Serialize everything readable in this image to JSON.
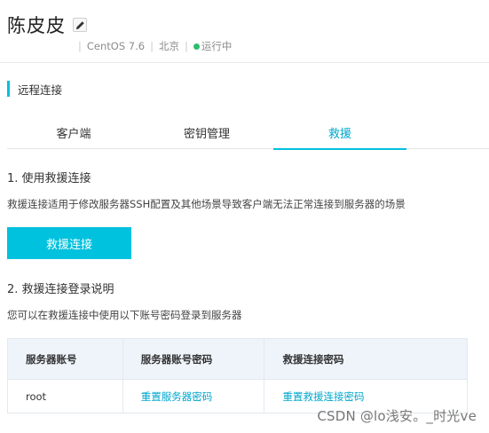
{
  "header": {
    "title": "陈皮皮",
    "os": "CentOS 7.6",
    "region": "北京",
    "status": "运行中",
    "status_color": "#2dbd6e"
  },
  "section": {
    "title": "远程连接"
  },
  "tabs": [
    {
      "label": "客户端",
      "active": false
    },
    {
      "label": "密钥管理",
      "active": false
    },
    {
      "label": "救援",
      "active": true
    }
  ],
  "step1": {
    "heading": "1. 使用救援连接",
    "description": "救援连接适用于修改服务器SSH配置及其他场景导致客户端无法正常连接到服务器的场景",
    "button_label": "救援连接"
  },
  "step2": {
    "heading": "2. 救援连接登录说明",
    "description": "您可以在救援连接中使用以下账号密码登录到服务器"
  },
  "table": {
    "headers": [
      "服务器账号",
      "服务器账号密码",
      "救援连接密码"
    ],
    "rows": [
      [
        "root",
        "重置服务器密码",
        "重置救援连接密码"
      ]
    ]
  },
  "watermark": "CSDN @lo浅安。_时光ve",
  "accent_color": "#00c1de"
}
